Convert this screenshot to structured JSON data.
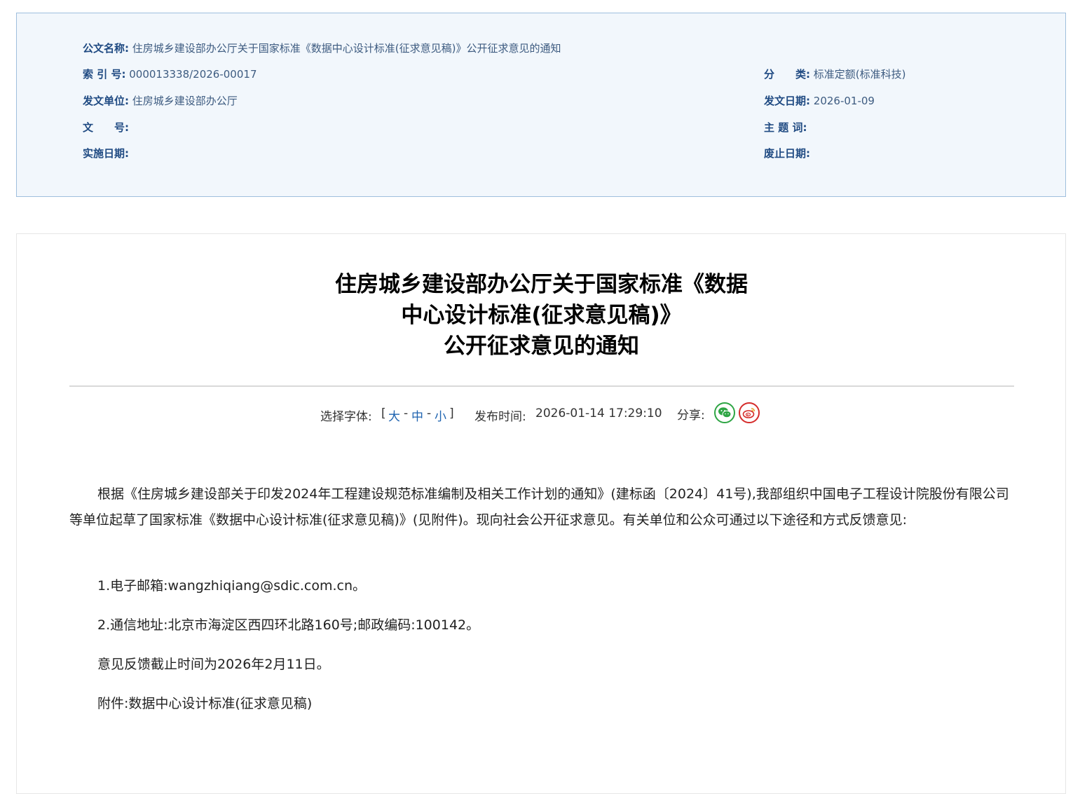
{
  "meta": {
    "name_label": "公文名称:",
    "name_value": "住房城乡建设部办公厅关于国家标准《数据中心设计标准(征求意见稿)》公开征求意见的通知",
    "index_label": "索 引 号:",
    "index_value": "000013338/2026-00017",
    "category_label": "分　　类:",
    "category_value": "标准定额(标准科技)",
    "issuer_label": "发文单位:",
    "issuer_value": "住房城乡建设部办公厅",
    "issue_date_label": "发文日期:",
    "issue_date_value": "2026-01-09",
    "doc_no_label": "文　　号:",
    "doc_no_value": "",
    "keywords_label": "主 题 词:",
    "keywords_value": "",
    "effective_label": "实施日期:",
    "effective_value": "",
    "expiry_label": "废止日期:",
    "expiry_value": ""
  },
  "article": {
    "title_lines": [
      "住房城乡建设部办公厅关于国家标准《数据",
      "中心设计标准(征求意见稿)》",
      "公开征求意见的通知"
    ],
    "font_select_label": "选择字体:",
    "bracket_open": "[",
    "bracket_close": "]",
    "font_large": "大",
    "font_medium": "中",
    "font_small": "小",
    "separator": "-",
    "publish_label": "发布时间:",
    "publish_time": "2026-01-14 17:29:10",
    "share_label": "分享:",
    "paragraphs": [
      "根据《住房城乡建设部关于印发2024年工程建设规范标准编制及相关工作计划的通知》(建标函〔2024〕41号),我部组织中国电子工程设计院股份有限公司等单位起草了国家标准《数据中心设计标准(征求意见稿)》(见附件)。现向社会公开征求意见。有关单位和公众可通过以下途径和方式反馈意见:",
      "1.电子邮箱:wangzhiqiang@sdic.com.cn。",
      "2.通信地址:北京市海淀区西四环北路160号;邮政编码:100142。",
      "意见反馈截止时间为2026年2月11日。",
      "附件:数据中心设计标准(征求意见稿)"
    ]
  },
  "colors": {
    "meta_bg": "#f2f7fc",
    "meta_border": "#9fbfdd",
    "label": "#1f4a82",
    "link": "#1e63b0",
    "wechat": "#2ea544",
    "weibo": "#d52c2b"
  },
  "icons": [
    "wechat-icon",
    "weibo-icon"
  ]
}
